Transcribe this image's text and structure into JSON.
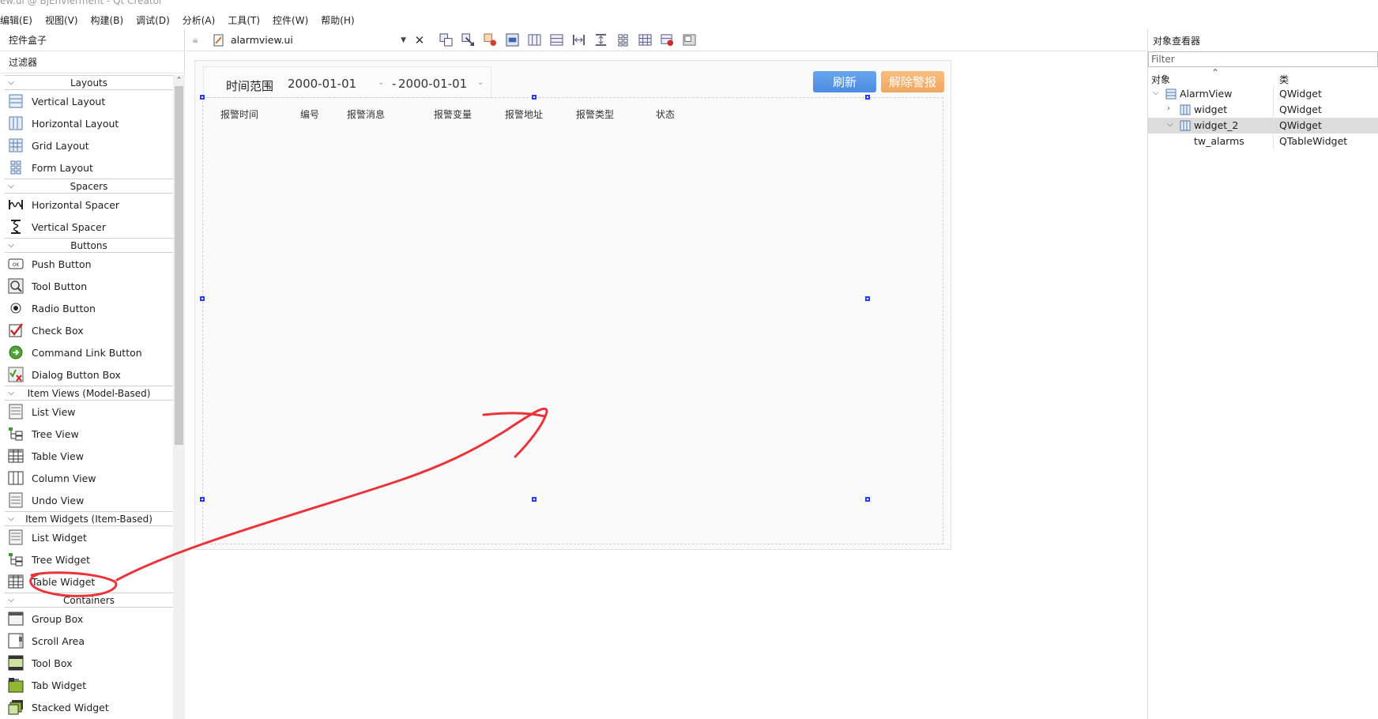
{
  "window": {
    "title_fragment": "ew.ui @ BjEnvierment - Qt Creator"
  },
  "menu": [
    "编辑(E)",
    "视图(V)",
    "构建(B)",
    "调试(D)",
    "分析(A)",
    "工具(T)",
    "控件(W)",
    "帮助(H)"
  ],
  "widget_box": {
    "title": "控件盒子",
    "filter": "过滤器",
    "categories": {
      "layouts": "Layouts",
      "spacers": "Spacers",
      "buttons": "Buttons",
      "item_views": "Item Views (Model-Based)",
      "item_widgets": "Item Widgets (Item-Based)",
      "containers": "Containers"
    },
    "items": {
      "vertical_layout": "Vertical Layout",
      "horizontal_layout": "Horizontal Layout",
      "grid_layout": "Grid Layout",
      "form_layout": "Form Layout",
      "horizontal_spacer": "Horizontal Spacer",
      "vertical_spacer": "Vertical Spacer",
      "push_button": "Push Button",
      "tool_button": "Tool Button",
      "radio_button": "Radio Button",
      "check_box": "Check Box",
      "command_link_button": "Command Link Button",
      "dialog_button_box": "Dialog Button Box",
      "list_view": "List View",
      "tree_view": "Tree View",
      "table_view": "Table View",
      "column_view": "Column View",
      "undo_view": "Undo View",
      "list_widget": "List Widget",
      "tree_widget": "Tree Widget",
      "table_widget": "Table Widget",
      "group_box": "Group Box",
      "scroll_area": "Scroll Area",
      "tool_box": "Tool Box",
      "tab_widget": "Tab Widget",
      "stacked_widget": "Stacked Widget"
    }
  },
  "editor": {
    "file_name": "alarmview.ui"
  },
  "form": {
    "range_label": "时间范围",
    "date_from": "2000-01-01",
    "date_separator": "-",
    "date_to": "2000-01-01",
    "refresh_button": "刷新",
    "clear_alarm_button": "解除警报",
    "columns": [
      "报警时间",
      "编号",
      "报警消息",
      "报警变量",
      "报警地址",
      "报警类型",
      "状态"
    ]
  },
  "object_inspector": {
    "title": "对象查看器",
    "filter_placeholder": "Filter",
    "col_object": "对象",
    "col_class": "类",
    "rows": [
      {
        "name": "AlarmView",
        "class": "QWidget"
      },
      {
        "name": "widget",
        "class": "QWidget"
      },
      {
        "name": "widget_2",
        "class": "QWidget"
      },
      {
        "name": "tw_alarms",
        "class": "QTableWidget"
      }
    ]
  },
  "colors": {
    "refresh_button": "#4a8be0",
    "clear_alarm_button": "#f0a65f",
    "selection_handle": "#2a3bff",
    "annotation_stroke": "#e8343a"
  }
}
